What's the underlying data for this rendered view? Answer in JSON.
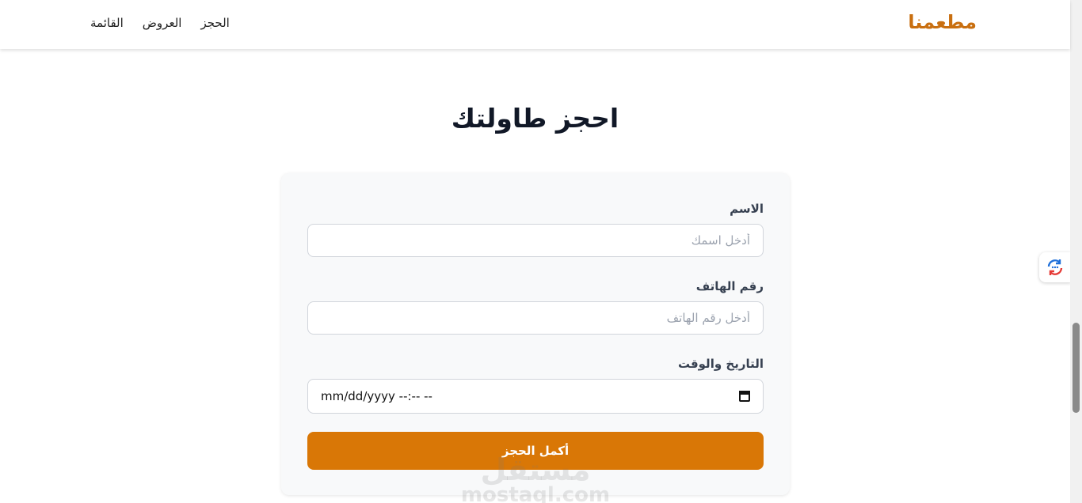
{
  "nav": {
    "brand": "مطعمنا",
    "links": [
      {
        "label": "القائمة"
      },
      {
        "label": "العروض"
      },
      {
        "label": "الحجز"
      }
    ]
  },
  "page": {
    "title": "احجز طاولتك"
  },
  "form": {
    "name": {
      "label": "الاسم",
      "placeholder": "أدخل اسمك"
    },
    "phone": {
      "label": "رقم الهاتف",
      "placeholder": "أدخل رقم الهاتف"
    },
    "datetime": {
      "label": "التاريخ والوقت",
      "value": "mm/dd/yyyy --:-- --"
    },
    "submit_label": "أكمل الحجز"
  },
  "watermark": {
    "arabic": "مستقل",
    "latin": "mostaql.com"
  },
  "colors": {
    "brand": "#c96f10",
    "button": "#d97706"
  },
  "icons": {
    "side_widget": "refresh-chat-icon",
    "date_picker": "calendar-icon"
  }
}
